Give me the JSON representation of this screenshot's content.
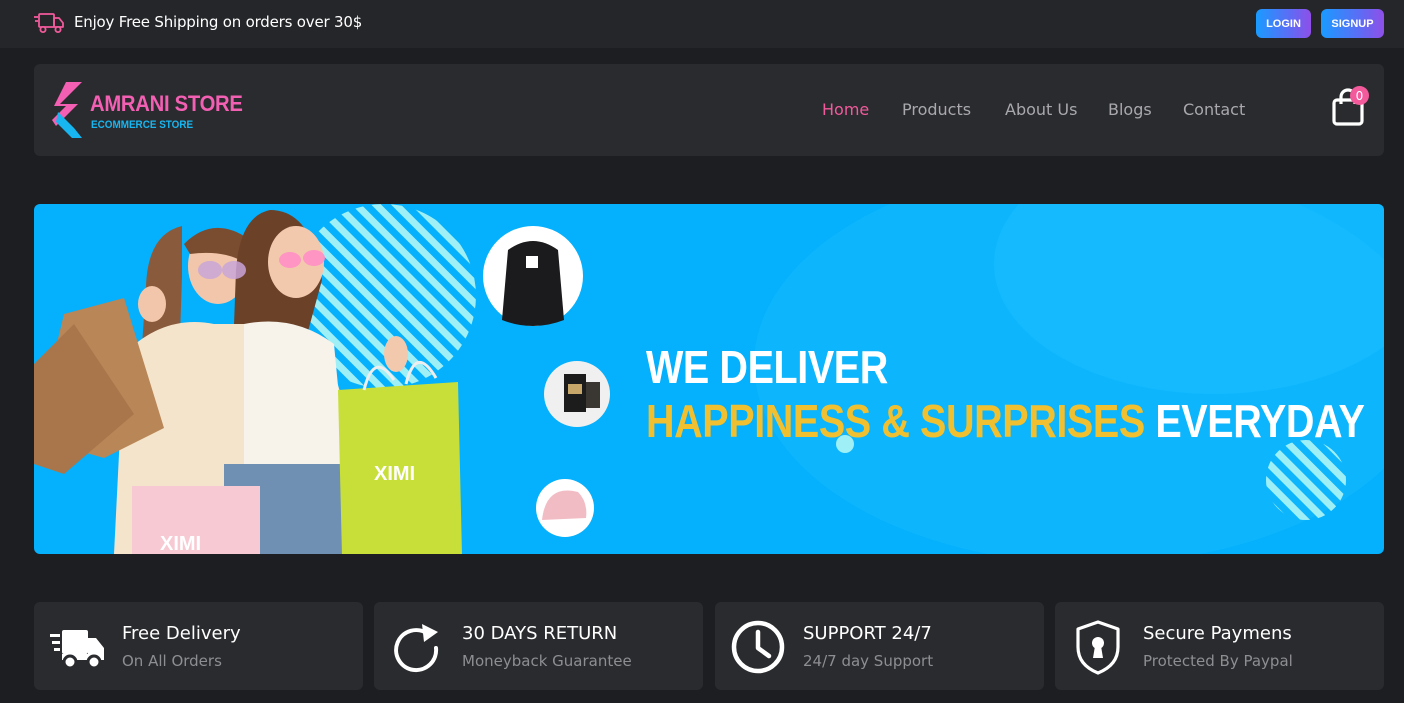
{
  "topbar": {
    "shipping_icon": "truck-icon",
    "shipping_text": "Enjoy Free Shipping on orders over 30$",
    "login_label": "LOGIN",
    "signup_label": "SIGNUP"
  },
  "header": {
    "logo_title": "AMRANI STORE",
    "logo_subtitle": "ECOMMERCE STORE",
    "nav": [
      {
        "label": "Home",
        "active": true
      },
      {
        "label": "Products",
        "active": false
      },
      {
        "label": "About Us",
        "active": false
      },
      {
        "label": "Blogs",
        "active": false
      },
      {
        "label": "Contact",
        "active": false
      }
    ],
    "cart_icon": "shopping-bag-icon",
    "cart_count": "0"
  },
  "banner": {
    "line1": "WE DELIVER",
    "line2_accent": "HAPPINESS & SURPRISES",
    "line2_rest": "EVERYDAY",
    "bag_brand": "XIMI",
    "bg_color": "#05b0fc",
    "accent_color": "#f0c030"
  },
  "features": [
    {
      "icon": "delivery-truck-icon",
      "title": "Free Delivery",
      "subtitle": "On All Orders"
    },
    {
      "icon": "return-arrow-icon",
      "title": "30 DAYS RETURN",
      "subtitle": "Moneyback Guarantee"
    },
    {
      "icon": "clock-icon",
      "title": "SUPPORT 24/7",
      "subtitle": "24/7 day Support"
    },
    {
      "icon": "shield-lock-icon",
      "title": "Secure Paymens",
      "subtitle": "Protected By Paypal"
    }
  ],
  "colors": {
    "page_bg": "#1d1e21",
    "panel_bg": "#2a2b2e",
    "pink": "#f25a9c",
    "blue": "#18b6f0"
  }
}
